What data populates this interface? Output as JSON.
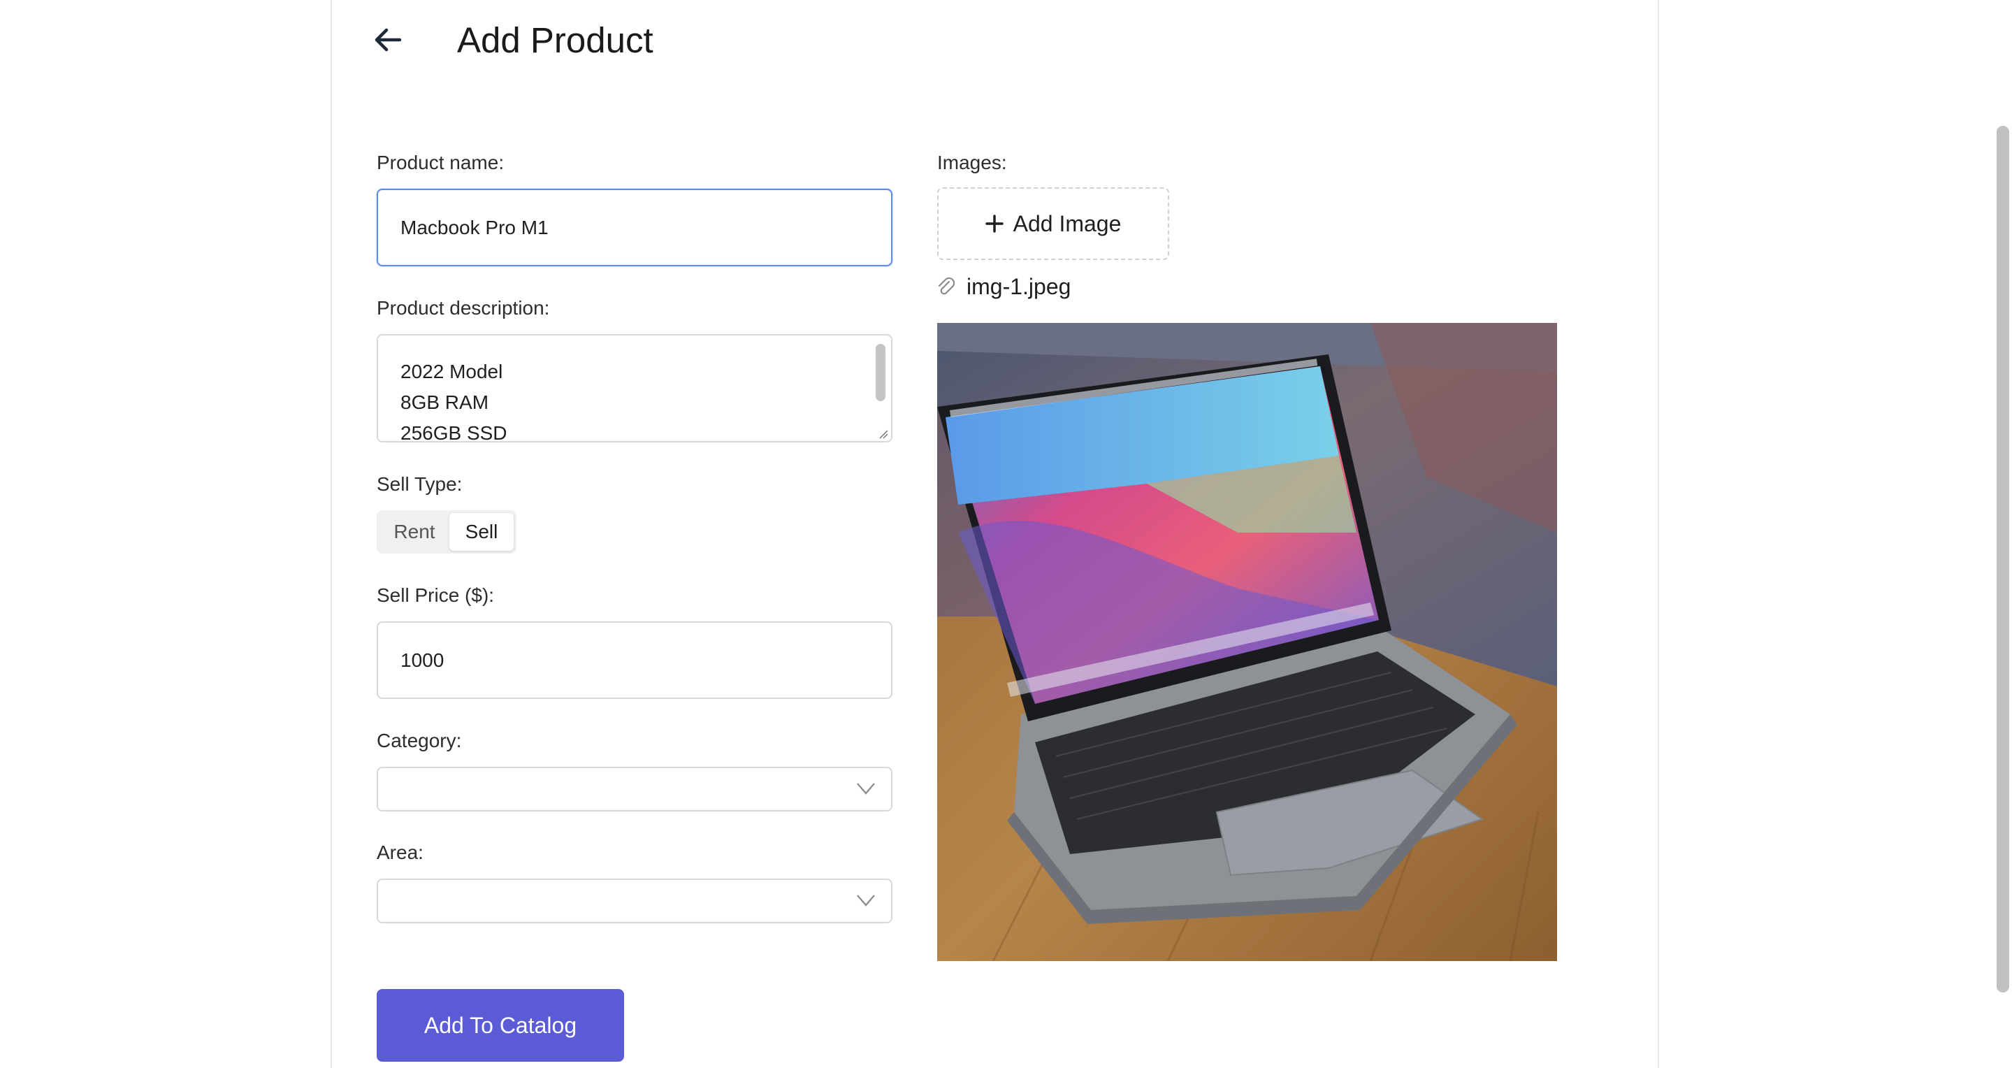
{
  "header": {
    "title": "Add Product"
  },
  "form": {
    "product_name": {
      "label": "Product name:",
      "value": "Macbook Pro M1"
    },
    "product_description": {
      "label": "Product description:",
      "lines": [
        "2022 Model",
        "8GB RAM",
        "256GB SSD"
      ]
    },
    "sell_type": {
      "label": "Sell Type:",
      "options": [
        "Rent",
        "Sell"
      ],
      "selected": "Sell"
    },
    "sell_price": {
      "label": "Sell Price ($):",
      "value": "1000"
    },
    "category": {
      "label": "Category:",
      "value": ""
    },
    "area": {
      "label": "Area:",
      "value": ""
    },
    "submit_label": "Add To Catalog"
  },
  "images": {
    "label": "Images:",
    "add_button_label": "Add Image",
    "files": [
      {
        "name": "img-1.jpeg"
      }
    ]
  },
  "colors": {
    "primary": "#5b5bd6",
    "focus_border": "#5b8cf0",
    "border": "#d9d9d9"
  }
}
